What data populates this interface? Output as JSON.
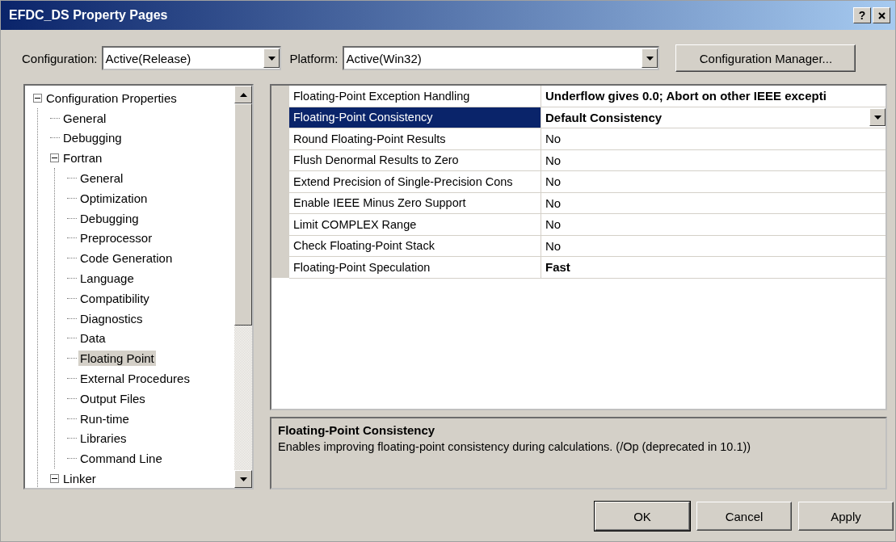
{
  "window": {
    "title": "EFDC_DS Property Pages",
    "help_button": "?"
  },
  "configuration": {
    "label": "Configuration:",
    "value": "Active(Release)"
  },
  "platform": {
    "label": "Platform:",
    "value": "Active(Win32)"
  },
  "configuration_manager_button": "Configuration Manager...",
  "tree": [
    {
      "label": "Configuration Properties",
      "expanded": true,
      "selected": false,
      "children": [
        {
          "label": "General",
          "selected": false
        },
        {
          "label": "Debugging",
          "selected": false
        },
        {
          "label": "Fortran",
          "expanded": true,
          "selected": false,
          "children": [
            {
              "label": "General",
              "selected": false
            },
            {
              "label": "Optimization",
              "selected": false
            },
            {
              "label": "Debugging",
              "selected": false
            },
            {
              "label": "Preprocessor",
              "selected": false
            },
            {
              "label": "Code Generation",
              "selected": false
            },
            {
              "label": "Language",
              "selected": false
            },
            {
              "label": "Compatibility",
              "selected": false
            },
            {
              "label": "Diagnostics",
              "selected": false
            },
            {
              "label": "Data",
              "selected": false
            },
            {
              "label": "Floating Point",
              "selected": true
            },
            {
              "label": "External Procedures",
              "selected": false
            },
            {
              "label": "Output Files",
              "selected": false
            },
            {
              "label": "Run-time",
              "selected": false
            },
            {
              "label": "Libraries",
              "selected": false
            },
            {
              "label": "Command Line",
              "selected": false
            }
          ]
        },
        {
          "label": "Linker",
          "expanded": true,
          "selected": false
        }
      ]
    }
  ],
  "properties": [
    {
      "name": "Floating-Point Exception Handling",
      "value": "Underflow gives 0.0; Abort on other IEEE excepti",
      "modified": true,
      "selected": false
    },
    {
      "name": "Floating-Point Consistency",
      "value": "Default Consistency",
      "modified": true,
      "selected": true
    },
    {
      "name": "Round Floating-Point Results",
      "value": "No",
      "modified": false,
      "selected": false
    },
    {
      "name": "Flush Denormal Results to Zero",
      "value": "No",
      "modified": false,
      "selected": false
    },
    {
      "name": "Extend Precision of Single-Precision Cons",
      "value": "No",
      "modified": false,
      "selected": false
    },
    {
      "name": "Enable IEEE Minus Zero Support",
      "value": "No",
      "modified": false,
      "selected": false
    },
    {
      "name": "Limit COMPLEX Range",
      "value": "No",
      "modified": false,
      "selected": false
    },
    {
      "name": "Check Floating-Point Stack",
      "value": "No",
      "modified": false,
      "selected": false
    },
    {
      "name": "Floating-Point Speculation",
      "value": "Fast",
      "modified": true,
      "selected": false
    }
  ],
  "description": {
    "title": "Floating-Point Consistency",
    "text": "Enables improving floating-point consistency during calculations. (/Op (deprecated in 10.1))"
  },
  "buttons": [
    "OK",
    "Cancel",
    "Apply"
  ]
}
